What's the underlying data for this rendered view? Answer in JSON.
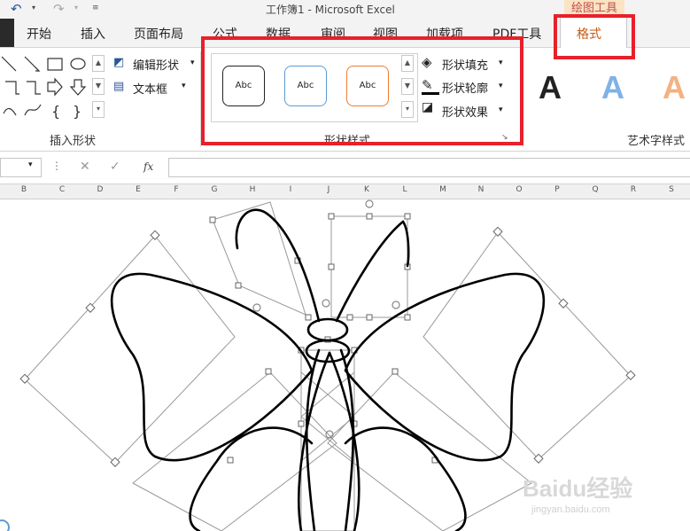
{
  "window": {
    "title": "工作簿1 - Microsoft Excel",
    "context_tab_group": "绘图工具"
  },
  "quick_access": {
    "undo_icon": "undo-icon",
    "redo_icon": "redo-icon",
    "customize_icon": "customize-qat-icon"
  },
  "tabs": [
    "开始",
    "插入",
    "页面布局",
    "公式",
    "数据",
    "审阅",
    "视图",
    "加载项",
    "PDF工具"
  ],
  "active_tab": "格式",
  "ribbon": {
    "insert_shapes": {
      "label": "插入形状",
      "edit_shape": "编辑形状",
      "text_box": "文本框"
    },
    "shape_styles": {
      "label": "形状样式",
      "presets": [
        {
          "text": "Abc",
          "border_color": "#222222"
        },
        {
          "text": "Abc",
          "border_color": "#5b9bd5"
        },
        {
          "text": "Abc",
          "border_color": "#ed7d31"
        }
      ],
      "shape_fill": "形状填充",
      "shape_outline": "形状轮廓",
      "shape_effects": "形状效果"
    },
    "wordart_styles": {
      "label": "艺术字样式",
      "samples": [
        {
          "text": "A",
          "color": "#000000"
        },
        {
          "text": "A",
          "color": "#5b9bd5"
        },
        {
          "text": "A",
          "color": "#ed7d31"
        }
      ]
    }
  },
  "formula_bar": {
    "fx_label": "fx",
    "value": ""
  },
  "columns": [
    "B",
    "C",
    "D",
    "E",
    "F",
    "G",
    "H",
    "I",
    "J",
    "K",
    "L",
    "M",
    "N",
    "O",
    "P",
    "Q",
    "R",
    "S"
  ],
  "colors": {
    "highlight": "#e8202a",
    "active_tab_text": "#c55a11",
    "accent": "#2b579a"
  },
  "watermark": {
    "brand": "Baidu经验",
    "url": "jingyan.baidu.com"
  }
}
